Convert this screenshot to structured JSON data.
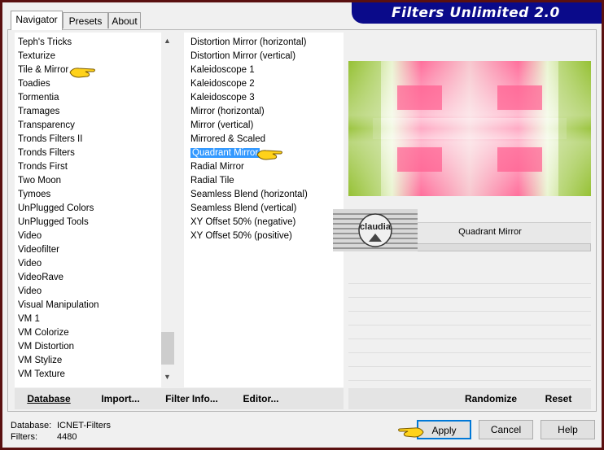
{
  "app_title": "Filters Unlimited 2.0",
  "tabs": [
    {
      "label": "Navigator",
      "active": true
    },
    {
      "label": "Presets",
      "active": false
    },
    {
      "label": "About",
      "active": false
    }
  ],
  "categories": [
    "Teph's Tricks",
    "Texturize",
    "Tile & Mirror",
    "Toadies",
    "Tormentia",
    "Tramages",
    "Transparency",
    "Tronds Filters II",
    "Tronds Filters",
    "Tronds First",
    "Two Moon",
    "Tymoes",
    "UnPlugged Colors",
    "UnPlugged Tools",
    "Video",
    "Videofilter",
    "Video",
    "VideoRave",
    "Video",
    "Visual Manipulation",
    "VM 1",
    "VM Colorize",
    "VM Distortion",
    "VM Stylize",
    "VM Texture"
  ],
  "selected_category": "Tile & Mirror",
  "filters": [
    "Distortion Mirror (horizontal)",
    "Distortion Mirror (vertical)",
    "Kaleidoscope 1",
    "Kaleidoscope 2",
    "Kaleidoscope 3",
    "Mirror (horizontal)",
    "Mirror (vertical)",
    "Mirrored & Scaled",
    "Quadrant Mirror",
    "Radial Mirror",
    "Radial Tile",
    "Seamless Blend (horizontal)",
    "Seamless Blend (vertical)",
    "XY Offset 50% (negative)",
    "XY Offset 50% (positive)"
  ],
  "selected_filter": "Quadrant Mirror",
  "filter_name_display": "Quadrant Mirror",
  "watermark": "claudia",
  "bottom_buttons": {
    "database": "Database",
    "import": "Import...",
    "filter_info": "Filter Info...",
    "editor": "Editor...",
    "randomize": "Randomize",
    "reset": "Reset"
  },
  "status": {
    "database_label": "Database:",
    "database_value": "ICNET-Filters",
    "filters_label": "Filters:",
    "filters_value": "4480"
  },
  "dialog_buttons": {
    "apply": "Apply",
    "cancel": "Cancel",
    "help": "Help"
  },
  "colors": {
    "title_bar": "#0a0a8a",
    "selection": "#3399ff",
    "frame": "#5a1010"
  }
}
